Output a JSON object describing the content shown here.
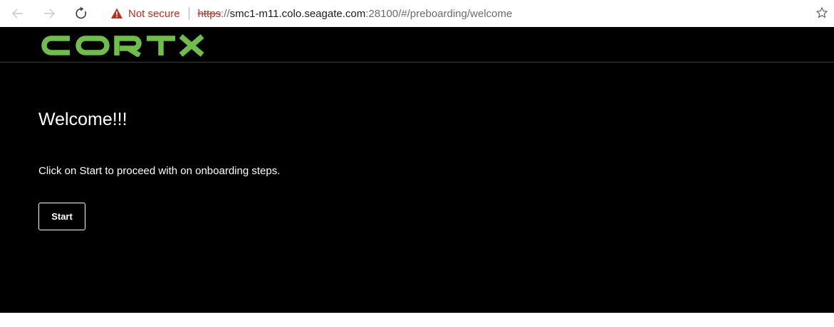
{
  "browser": {
    "security_label": "Not secure",
    "url_scheme": "https",
    "url_separator": "://",
    "url_host": "smc1-m11.colo.seagate.com",
    "url_rest": ":28100/#/preboarding/welcome",
    "icons": [
      "back-arrow-icon",
      "forward-arrow-icon",
      "refresh-icon",
      "warning-icon",
      "star-icon"
    ],
    "colors": {
      "insecure": "#c42b1c"
    }
  },
  "app": {
    "logo_text": "CORTX",
    "colors": {
      "background": "#000000",
      "logo": "#6ebe4a",
      "text": "#ffffff"
    }
  },
  "page": {
    "title": "Welcome!!!",
    "instruction": "Click on Start to proceed with on onboarding steps.",
    "start_label": "Start"
  }
}
